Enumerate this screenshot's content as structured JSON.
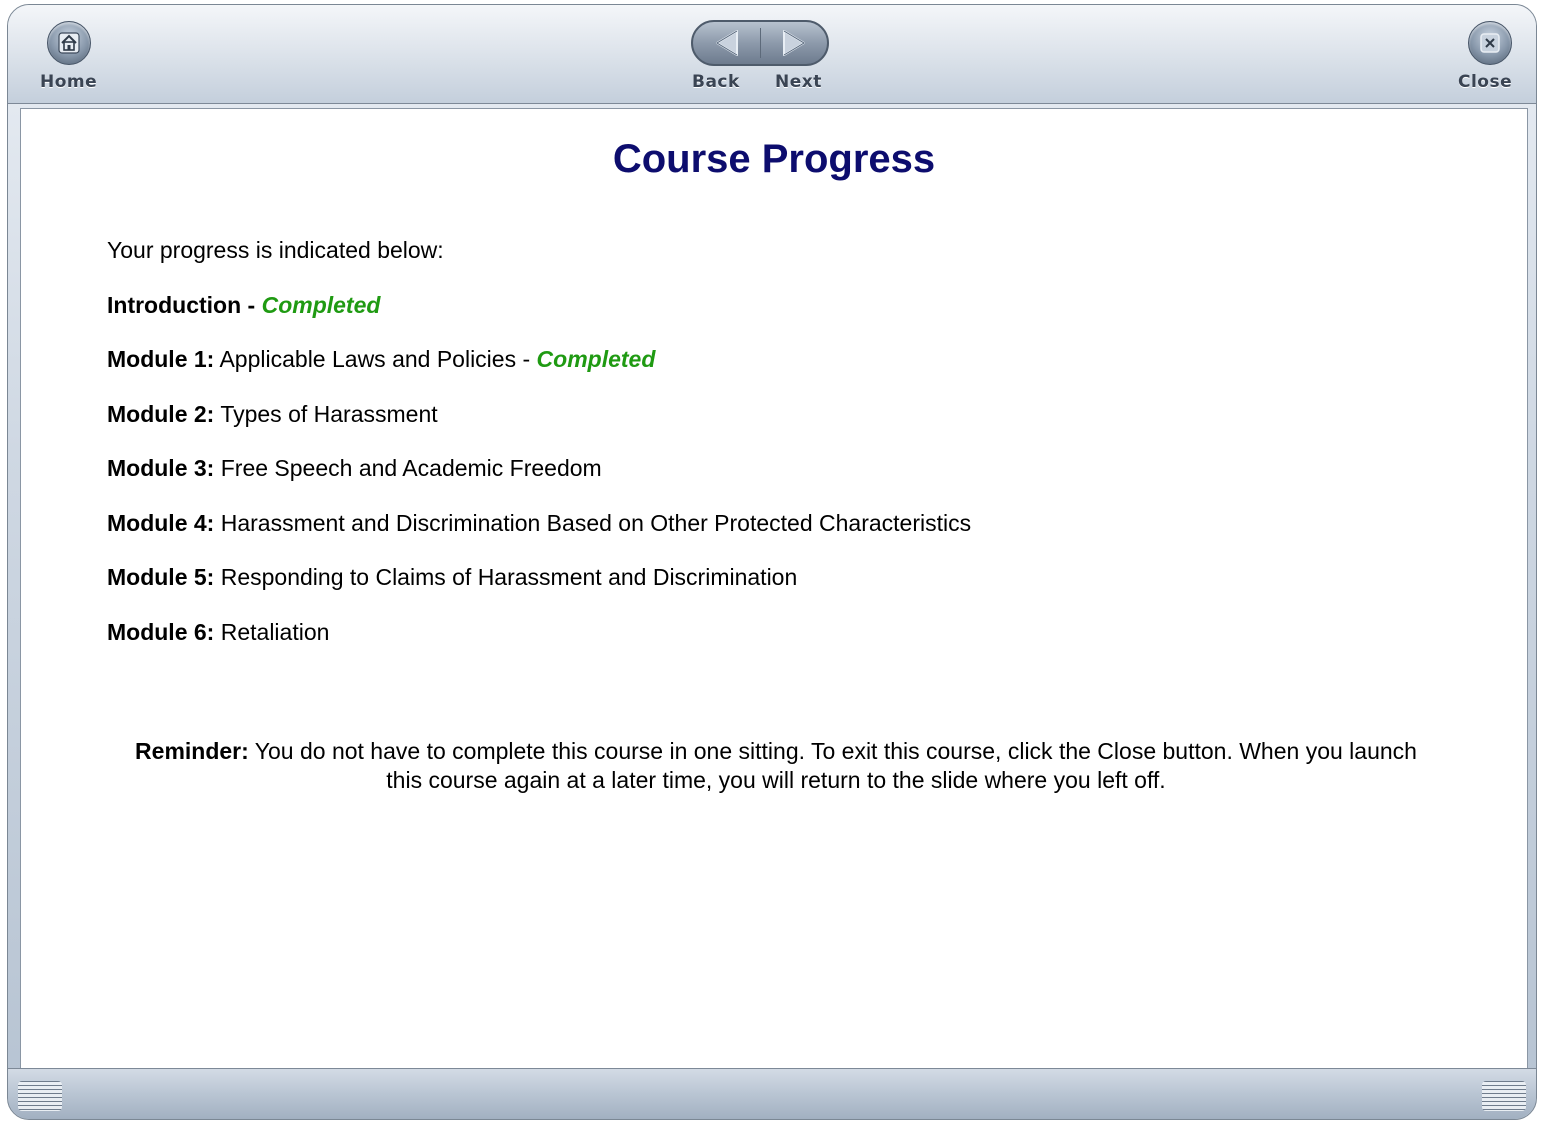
{
  "toolbar": {
    "home_label": "Home",
    "back_label": "Back",
    "next_label": "Next",
    "close_label": "Close",
    "icons": {
      "home": "home-icon",
      "back": "left-arrow-icon",
      "next": "right-arrow-icon",
      "close": "close-icon"
    }
  },
  "page": {
    "title": "Course Progress",
    "intro": "Your progress is indicated below:"
  },
  "progress": [
    {
      "label": "Introduction - ",
      "name": "",
      "separator": "",
      "status": "Completed"
    },
    {
      "label": "Module 1:",
      "name": " Applicable Laws and Policies",
      "separator": " - ",
      "status": "Completed"
    },
    {
      "label": "Module 2:",
      "name": " Types of Harassment",
      "separator": "",
      "status": ""
    },
    {
      "label": "Module 3:",
      "name": " Free Speech and Academic Freedom",
      "separator": "",
      "status": ""
    },
    {
      "label": "Module 4:",
      "name": " Harassment and Discrimination Based on Other Protected Characteristics",
      "separator": "",
      "status": ""
    },
    {
      "label": "Module 5:",
      "name": " Responding to Claims of Harassment and Discrimination",
      "separator": "",
      "status": ""
    },
    {
      "label": "Module 6:",
      "name": " Retaliation",
      "separator": "",
      "status": ""
    }
  ],
  "reminder": {
    "label": "Reminder:",
    "text": " You do not have to complete this course in one sitting. To exit this course, click the Close button. When you launch this course again at a later time, you will return to the slide where you left off."
  },
  "colors": {
    "title": "#0d0d6e",
    "completed": "#1f9a12"
  }
}
